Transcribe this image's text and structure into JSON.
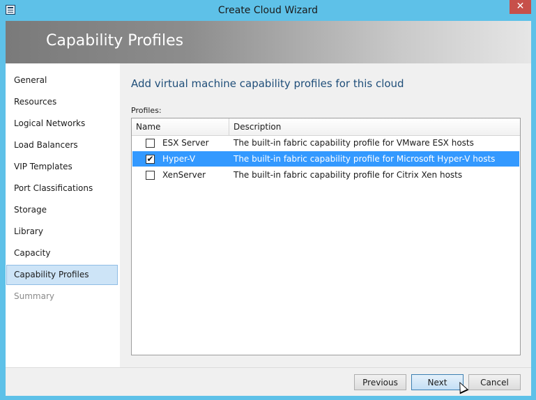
{
  "window": {
    "title": "Create Cloud Wizard",
    "close_label": "✕"
  },
  "banner": {
    "title": "Capability Profiles"
  },
  "nav": {
    "items": [
      {
        "label": "General",
        "state": "normal"
      },
      {
        "label": "Resources",
        "state": "normal"
      },
      {
        "label": "Logical Networks",
        "state": "normal"
      },
      {
        "label": "Load Balancers",
        "state": "normal"
      },
      {
        "label": "VIP Templates",
        "state": "normal"
      },
      {
        "label": "Port Classifications",
        "state": "normal"
      },
      {
        "label": "Storage",
        "state": "normal"
      },
      {
        "label": "Library",
        "state": "normal"
      },
      {
        "label": "Capacity",
        "state": "normal"
      },
      {
        "label": "Capability Profiles",
        "state": "active"
      },
      {
        "label": "Summary",
        "state": "disabled"
      }
    ]
  },
  "main": {
    "heading": "Add virtual machine capability profiles for this cloud",
    "profiles_label": "Profiles:",
    "columns": {
      "name": "Name",
      "description": "Description"
    },
    "rows": [
      {
        "name": "ESX Server",
        "description": "The built-in fabric capability profile for VMware ESX hosts",
        "checked": false,
        "selected": false
      },
      {
        "name": "Hyper-V",
        "description": "The built-in fabric capability profile for Microsoft Hyper-V hosts",
        "checked": true,
        "selected": true
      },
      {
        "name": "XenServer",
        "description": "The built-in fabric capability profile for Citrix Xen hosts",
        "checked": false,
        "selected": false
      }
    ]
  },
  "footer": {
    "previous_label": "Previous",
    "next_label": "Next",
    "cancel_label": "Cancel"
  },
  "icons": {
    "app": "wizard-app-icon",
    "close": "close-icon",
    "check": "checkmark-icon",
    "cursor": "mouse-pointer-icon"
  },
  "colors": {
    "window_frame": "#5ec1e8",
    "selection": "#3399ff",
    "heading": "#1f4e79",
    "close_button": "#c7504a"
  }
}
